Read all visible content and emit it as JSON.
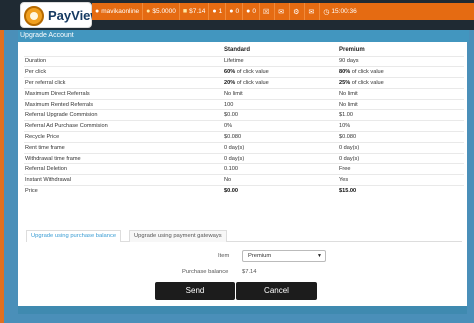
{
  "brand": {
    "name": "PayView"
  },
  "menu": {
    "username": "mavikaonline",
    "balance1": "$5.0000",
    "balance2": "$7.14",
    "count1": "1",
    "count2": "0",
    "count3": "0",
    "time": "15:00:36"
  },
  "section": {
    "title": "Upgrade Account"
  },
  "compare": {
    "headers": [
      "",
      "Standard",
      "Premium"
    ],
    "rows": [
      [
        "Duration",
        "Lifetime",
        "90 days"
      ],
      [
        "Per click",
        "60% of click value",
        "80% of click value"
      ],
      [
        "Per referral click",
        "20% of click value",
        "25% of click value"
      ],
      [
        "Maximum Direct Referrals",
        "No limit",
        "No limit"
      ],
      [
        "Maximum Rented Referrals",
        "100",
        "No limit"
      ],
      [
        "Referral Upgrade Commision",
        "$0.00",
        "$1.00"
      ],
      [
        "Referral Ad Purchase Commision",
        "0%",
        "10%"
      ],
      [
        "Recycle Price",
        "$0.080",
        "$0.080"
      ],
      [
        "Rent time frame",
        "0 day(s)",
        "0 day(s)"
      ],
      [
        "Withdrawal time frame",
        "0 day(s)",
        "0 day(s)"
      ],
      [
        "Referral Deletion",
        "0.100",
        "Free"
      ],
      [
        "Instant Withdrawal",
        "No",
        "Yes"
      ],
      [
        "Price",
        "$0.00",
        "$15.00"
      ]
    ],
    "bold_pct": {
      "r1s": "60%",
      "r1p": "80%",
      "r2s": "20%",
      "r2p": "25%"
    },
    "rest": {
      "r1s": " of click value",
      "r1p": " of click value",
      "r2s": " of click value",
      "r2p": " of click value"
    }
  },
  "tabs": {
    "purchase_balance": "Upgrade using purchase balance",
    "payment_gateways": "Upgrade using payment gateways"
  },
  "form": {
    "item_label": "Item",
    "item_value": "Premium",
    "balance_label": "Purchase balance",
    "balance_value": "$7.14",
    "send": "Send",
    "cancel": "Cancel"
  }
}
